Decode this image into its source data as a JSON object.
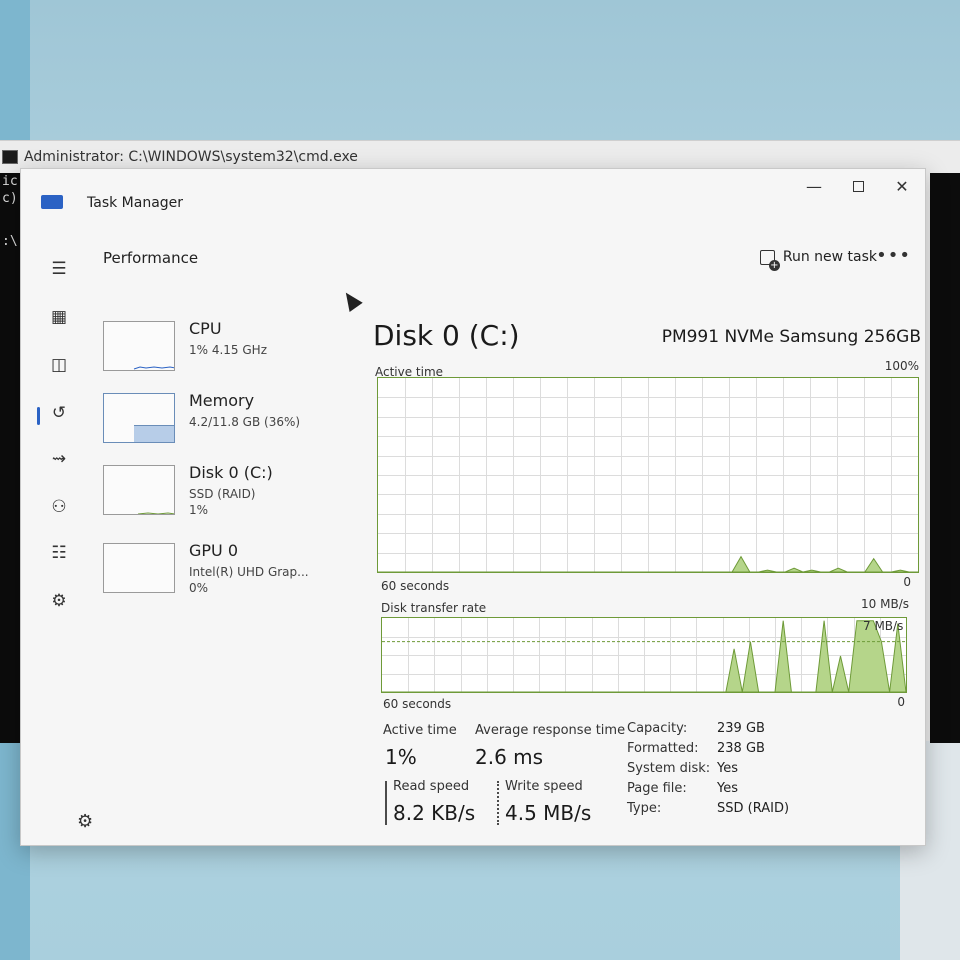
{
  "cmd": {
    "title": "Administrator: C:\\WINDOWS\\system32\\cmd.exe",
    "lines": [
      "ic",
      "c)",
      ":\\"
    ]
  },
  "app": {
    "title": "Task Manager",
    "section": "Performance",
    "run_new_task": "Run new task",
    "more_label": "•••"
  },
  "nav": {
    "items": [
      {
        "name": "hamburger-icon",
        "glyph": "☰"
      },
      {
        "name": "processes-icon",
        "glyph": "▦"
      },
      {
        "name": "performance-icon",
        "glyph": "◫"
      },
      {
        "name": "app-history-icon",
        "glyph": "↺"
      },
      {
        "name": "startup-apps-icon",
        "glyph": "⇝"
      },
      {
        "name": "users-icon",
        "glyph": "⚇"
      },
      {
        "name": "details-icon",
        "glyph": "☷"
      },
      {
        "name": "services-icon",
        "glyph": "⚙"
      }
    ],
    "settings_glyph": "⚙"
  },
  "perf_list": [
    {
      "name": "CPU",
      "line1": "1% 4.15 GHz",
      "line2": ""
    },
    {
      "name": "Memory",
      "line1": "4.2/11.8 GB (36%)",
      "line2": ""
    },
    {
      "name": "Disk 0 (C:)",
      "line1": "SSD (RAID)",
      "line2": "1%"
    },
    {
      "name": "GPU 0",
      "line1": "Intel(R) UHD Grap...",
      "line2": "0%"
    }
  ],
  "disk": {
    "title": "Disk 0 (C:)",
    "model": "PM991 NVMe Samsung 256GB",
    "active_time_label": "Active time",
    "active_time_max": "100%",
    "active_seconds": "60 seconds",
    "active_zero": "0",
    "transfer_label": "Disk transfer rate",
    "transfer_max": "10 MB/s",
    "transfer_ref": "7 MB/s",
    "transfer_seconds": "60 seconds",
    "transfer_zero": "0"
  },
  "stats": {
    "active_time_label": "Active time",
    "active_time_value": "1%",
    "avg_response_label": "Average response time",
    "avg_response_value": "2.6 ms",
    "read_label": "Read speed",
    "read_value": "8.2 KB/s",
    "write_label": "Write speed",
    "write_value": "4.5 MB/s"
  },
  "properties": [
    {
      "key": "Capacity:",
      "value": "239 GB"
    },
    {
      "key": "Formatted:",
      "value": "238 GB"
    },
    {
      "key": "System disk:",
      "value": "Yes"
    },
    {
      "key": "Page file:",
      "value": "Yes"
    },
    {
      "key": "Type:",
      "value": "SSD (RAID)"
    }
  ],
  "chart_data": [
    {
      "type": "area",
      "title": "Active time",
      "ylim": [
        0,
        100
      ],
      "unit": "%",
      "x_range_seconds": 60,
      "values": [
        0,
        0,
        0,
        0,
        0,
        0,
        0,
        0,
        0,
        0,
        0,
        0,
        0,
        0,
        0,
        0,
        0,
        0,
        0,
        0,
        0,
        0,
        0,
        0,
        0,
        0,
        0,
        0,
        0,
        0,
        0,
        0,
        0,
        0,
        0,
        0,
        0,
        0,
        0,
        0,
        0,
        8,
        0,
        0,
        1,
        0,
        0,
        2,
        0,
        1,
        0,
        0,
        2,
        0,
        0,
        0,
        7,
        0,
        0,
        1,
        0,
        0
      ]
    },
    {
      "type": "area",
      "title": "Disk transfer rate",
      "ylim": [
        0,
        10
      ],
      "unit": "MB/s",
      "reference_line": 7,
      "x_range_seconds": 60,
      "values": [
        0,
        0,
        0,
        0,
        0,
        0,
        0,
        0,
        0,
        0,
        0,
        0,
        0,
        0,
        0,
        0,
        0,
        0,
        0,
        0,
        0,
        0,
        0,
        0,
        0,
        0,
        0,
        0,
        0,
        0,
        0,
        0,
        0,
        0,
        0,
        0,
        0,
        0,
        0,
        0,
        0,
        0,
        0,
        6,
        0,
        7,
        0,
        0,
        0,
        9.9,
        0,
        0,
        0,
        0,
        9.9,
        0,
        5,
        0,
        9.9,
        9.9,
        9.9,
        7,
        0,
        9.5,
        0
      ]
    }
  ],
  "colors": {
    "accent": "#2b62c4",
    "disk_green": "#6e9a38",
    "disk_fill": "#b5d58a"
  }
}
